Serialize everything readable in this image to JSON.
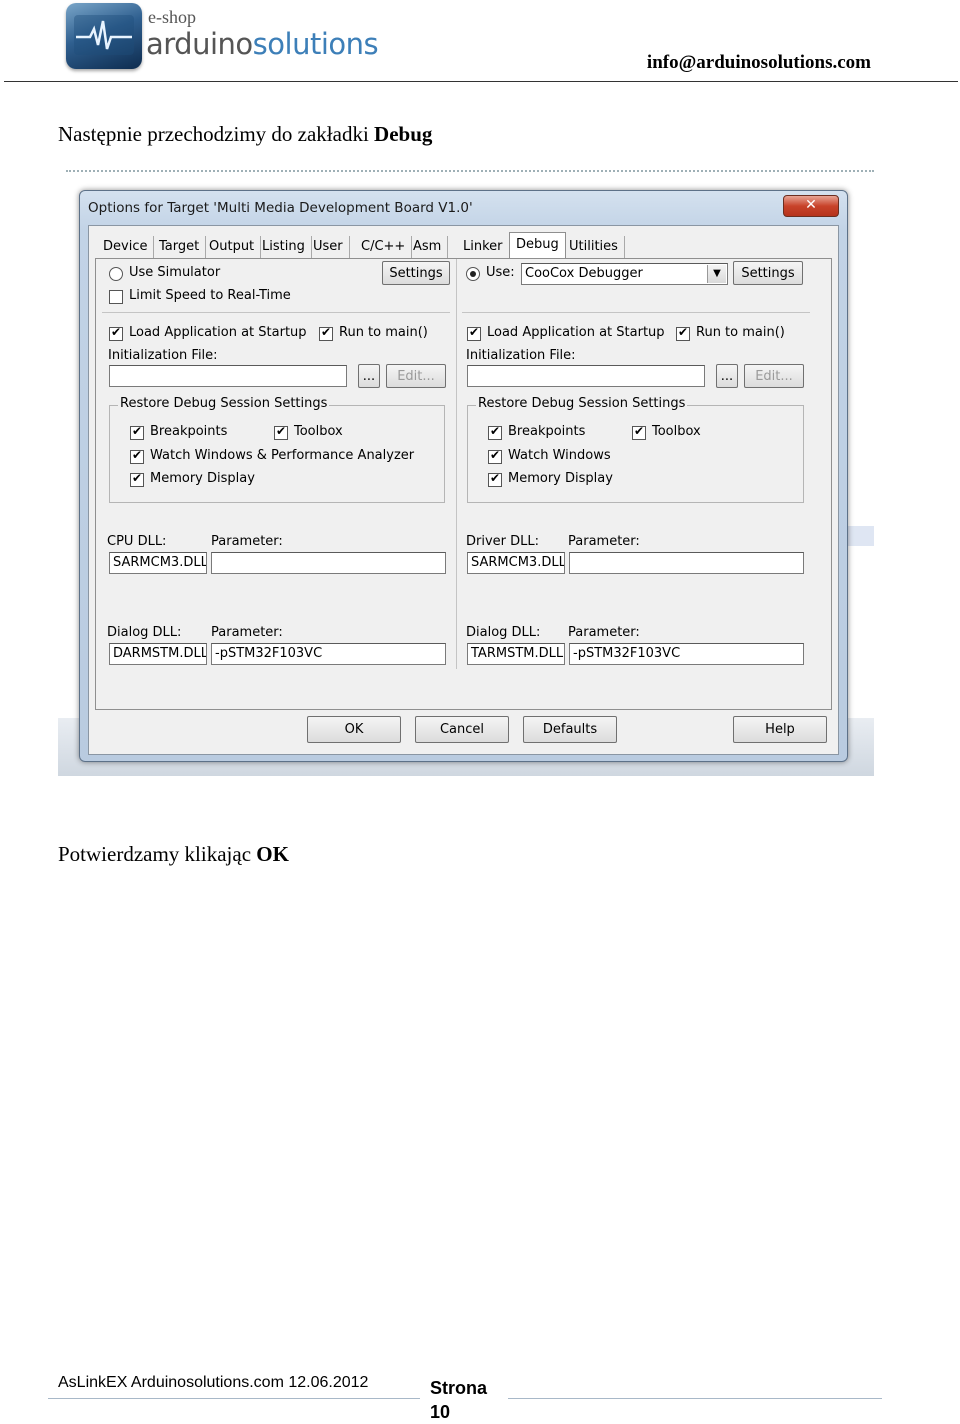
{
  "header": {
    "logo_eshop": "e-shop",
    "logo_name_part1": "arduino",
    "logo_name_part2": "solutions",
    "email": "info@arduinosolutions.com"
  },
  "paragraph1": {
    "text": "Następnie przechodzimy do zakładki ",
    "bold": "Debug"
  },
  "paragraph2": {
    "text": "Potwierdzamy klikając ",
    "bold": "OK"
  },
  "dialog": {
    "title": "Options for Target 'Multi Media Development Board V1.0'",
    "close_label": "✕",
    "tabs": [
      "Device",
      "Target",
      "Output",
      "Listing",
      "User",
      "C/C++",
      "Asm",
      "Linker",
      "Debug",
      "Utilities"
    ],
    "active_tab": "Debug",
    "left": {
      "use_simulator_label": "Use Simulator",
      "use_simulator_checked": false,
      "limit_speed_label": "Limit Speed to Real-Time",
      "limit_speed_checked": false,
      "settings_label": "Settings",
      "load_app_label": "Load Application at Startup",
      "load_app_checked": true,
      "run_main_label": "Run to main()",
      "run_main_checked": true,
      "init_file_label": "Initialization File:",
      "init_file_value": "",
      "browse_label": "...",
      "edit_label": "Edit...",
      "restore_group_title": "Restore Debug Session Settings",
      "breakpoints_label": "Breakpoints",
      "toolbox_label": "Toolbox",
      "watch_label": "Watch Windows & Performance Analyzer",
      "memory_label": "Memory Display",
      "cpu_dll_label": "CPU DLL:",
      "cpu_dll_value": "SARMCM3.DLL",
      "parameter_label": "Parameter:",
      "cpu_param_value": "",
      "dialog_dll_label": "Dialog DLL:",
      "dialog_dll_value": "DARMSTM.DLL",
      "dialog_param_value": "-pSTM32F103VC"
    },
    "right": {
      "use_label": "Use:",
      "use_checked": true,
      "debugger_value": "CooCox Debugger",
      "settings_label": "Settings",
      "load_app_label": "Load Application at Startup",
      "run_main_label": "Run to main()",
      "init_file_label": "Initialization File:",
      "init_file_value": "",
      "browse_label": "...",
      "edit_label": "Edit...",
      "restore_group_title": "Restore Debug Session Settings",
      "breakpoints_label": "Breakpoints",
      "toolbox_label": "Toolbox",
      "watch_label": "Watch Windows",
      "memory_label": "Memory Display",
      "driver_dll_label": "Driver DLL:",
      "driver_dll_value": "SARMCM3.DLL",
      "parameter_label": "Parameter:",
      "driver_param_value": "",
      "dialog_dll_label": "Dialog DLL:",
      "dialog_dll_value": "TARMSTM.DLL",
      "dialog_param_value": "-pSTM32F103VC"
    },
    "buttons": {
      "ok": "OK",
      "cancel": "Cancel",
      "defaults": "Defaults",
      "help": "Help"
    }
  },
  "footer": {
    "left_text": "AsLinkEX  Arduinosolutions.com 12.06.2012",
    "page_label": "Strona",
    "page_number": "10"
  },
  "colors": {
    "accent": "#3d7fb8",
    "dialog_frame": "#c2d3e6",
    "close_button": "#c8432a"
  }
}
